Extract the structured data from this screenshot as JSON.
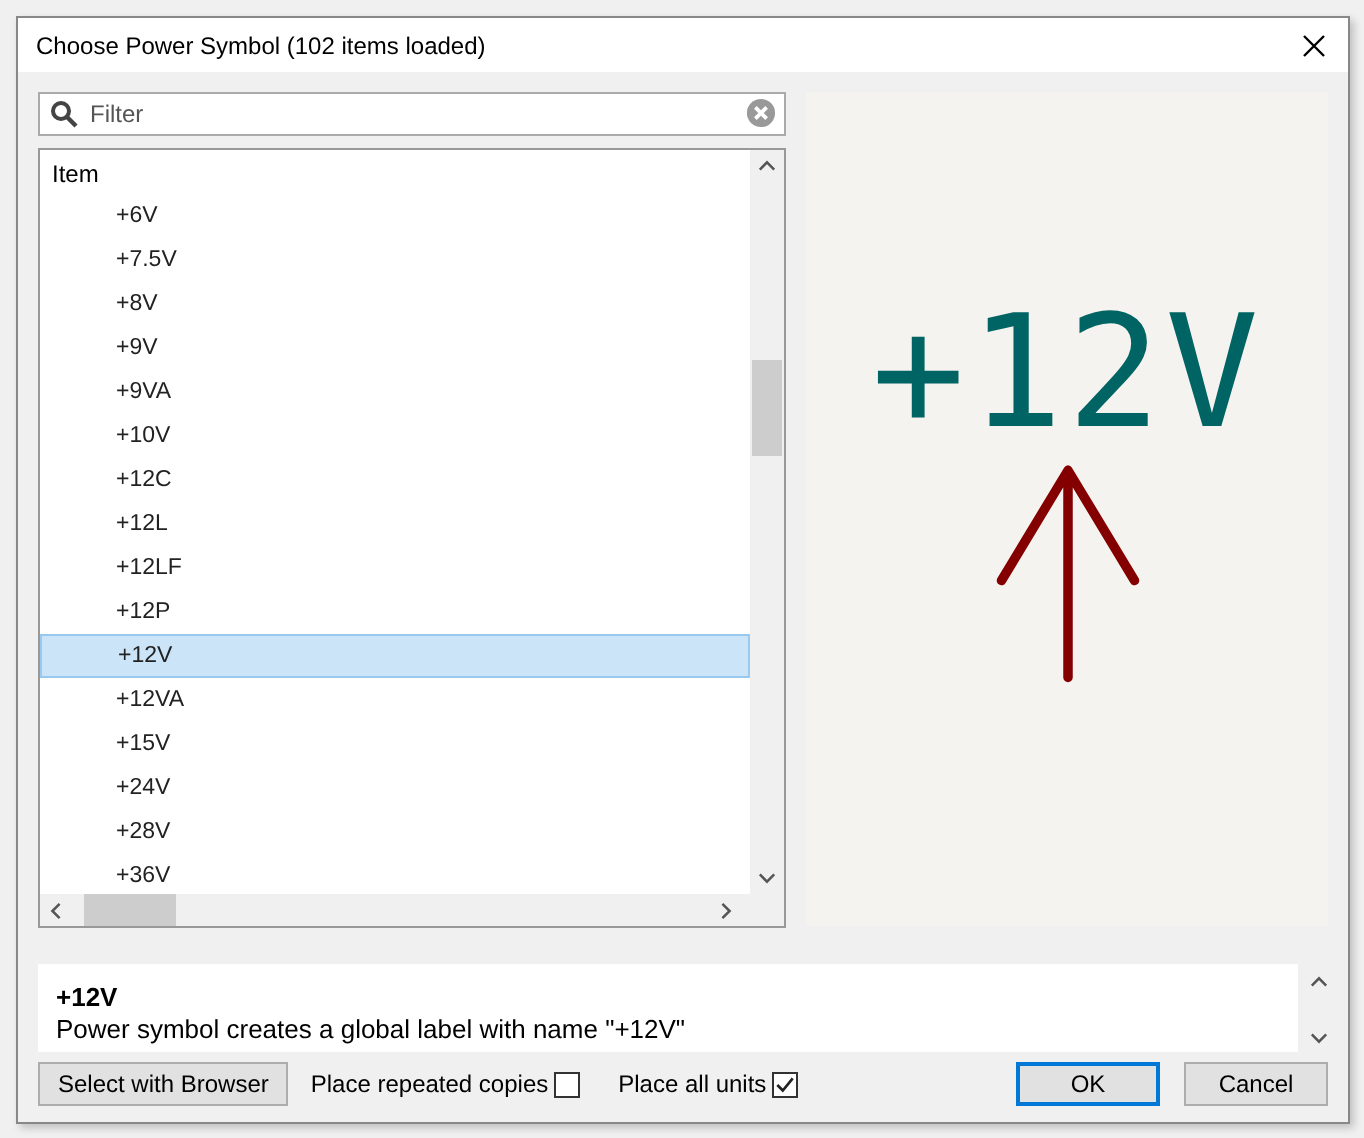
{
  "window": {
    "title": "Choose Power Symbol (102 items loaded)"
  },
  "filter": {
    "placeholder": "Filter"
  },
  "list": {
    "header": "Item",
    "items": [
      {
        "label": "+6V",
        "selected": false
      },
      {
        "label": "+7.5V",
        "selected": false
      },
      {
        "label": "+8V",
        "selected": false
      },
      {
        "label": "+9V",
        "selected": false
      },
      {
        "label": "+9VA",
        "selected": false
      },
      {
        "label": "+10V",
        "selected": false
      },
      {
        "label": "+12C",
        "selected": false
      },
      {
        "label": "+12L",
        "selected": false
      },
      {
        "label": "+12LF",
        "selected": false
      },
      {
        "label": "+12P",
        "selected": false
      },
      {
        "label": "+12V",
        "selected": true
      },
      {
        "label": "+12VA",
        "selected": false
      },
      {
        "label": "+15V",
        "selected": false
      },
      {
        "label": "+24V",
        "selected": false
      },
      {
        "label": "+28V",
        "selected": false
      },
      {
        "label": "+36V",
        "selected": false
      }
    ]
  },
  "preview": {
    "symbol_label": "+12V"
  },
  "description": {
    "title": "+12V",
    "text": "Power symbol creates a global label with name \"+12V\""
  },
  "options": [
    {
      "label": "Place repeated copies",
      "checked": false
    },
    {
      "label": "Place all units",
      "checked": true
    }
  ],
  "buttons": {
    "browser": "Select with Browser",
    "ok": "OK",
    "cancel": "Cancel"
  }
}
